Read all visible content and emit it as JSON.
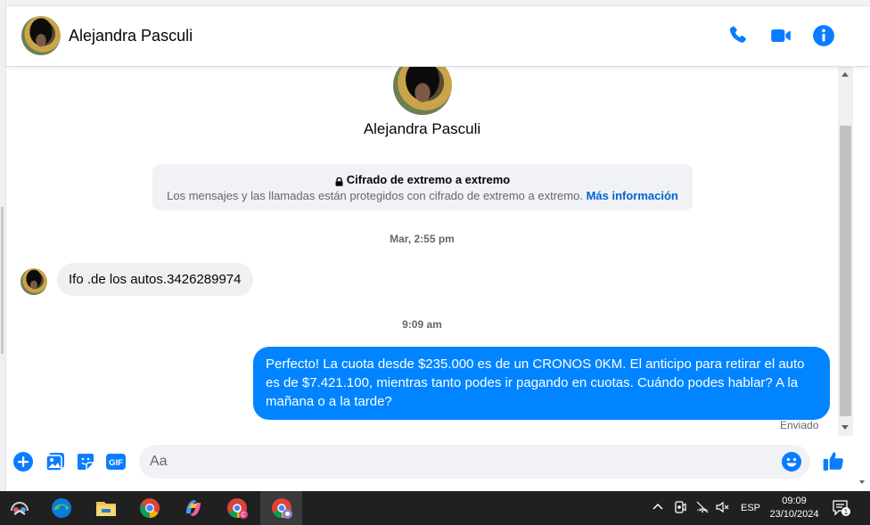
{
  "header": {
    "contact_name": "Alejandra Pasculi"
  },
  "profile": {
    "name": "Alejandra Pasculi"
  },
  "encryption": {
    "title": "Cifrado de extremo a extremo",
    "description": "Los mensajes y las llamadas están protegidos con cifrado de extremo a extremo.",
    "link": "Más información"
  },
  "messages": [
    {
      "timestamp": "Mar, 2:55 pm",
      "direction": "incoming",
      "text": "Ifo .de los autos.3426289974"
    },
    {
      "timestamp": "9:09 am",
      "direction": "outgoing",
      "text": "Perfecto! La cuota desde $235.000 es de un CRONOS 0KM. El anticipo para retirar el auto es de $7.421.100, mientras tanto podes ir pagando en cuotas. Cuándo podes hablar? A la mañana o a la tarde?",
      "status": "Enviado"
    }
  ],
  "composer": {
    "placeholder": "Aa",
    "gif_label": "GIF"
  },
  "taskbar": {
    "language": "ESP",
    "time": "09:09",
    "date": "23/10/2024",
    "notification_count": "1"
  },
  "colors": {
    "accent": "#0084ff",
    "icon_blue": "#0a7cff",
    "incoming_bubble": "#f0f0f0",
    "taskbar": "#202020"
  }
}
